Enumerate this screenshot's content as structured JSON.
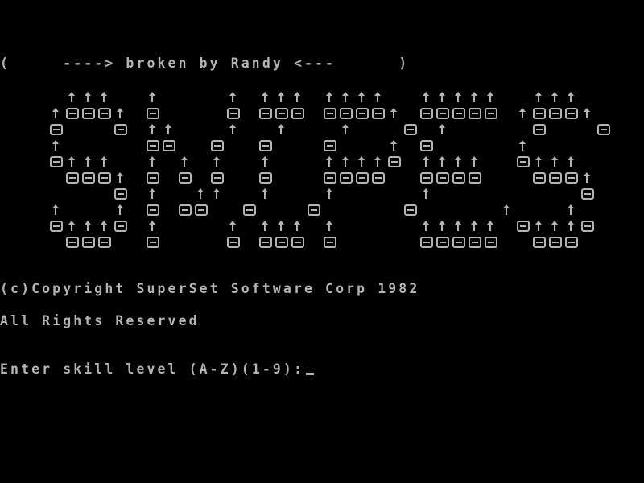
{
  "screen": {
    "crack_banner": "(     ----> broken by Randy <---      )",
    "copyright": "(c)Copyright SuperSet Software Corp 1982",
    "rights": "All Rights Reserved",
    "prompt": "Enter skill level (A-Z)(1-9):"
  },
  "logo": {
    "title": "SNIPES",
    "rows": [
      "    ^^^  ^    ^ ^^^ ^^^^  ^^^^^  ^^^",
      "   ^ooo^ o    o ooo oooo^ ooooo ^ooo^",
      "   o   o ^^   ^  ^   ^   o ^     o   o",
      "   ^     oo  o  o   o   ^ o     ^",
      "   o^^^  ^ ^ ^  ^   ^^^^o ^^^^  o^^^",
      "    ooo^ o o o  o   oooo  oooo   ooo^",
      "       o ^  ^^  ^   ^     ^         o",
      "   ^   ^ o oo  o   o     o     ^   ^",
      "   o^^^o ^    ^ ^^^ ^     ^^^^^ o^^^o",
      "    ooo  o    o ooo o     ooooo  ooo"
    ]
  }
}
